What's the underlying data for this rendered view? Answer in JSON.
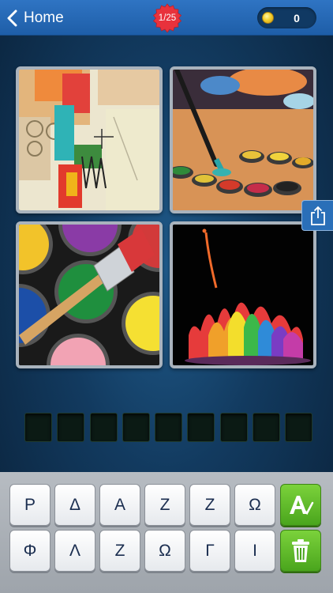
{
  "header": {
    "back_label": "Home",
    "level": "1/25",
    "coins": "0"
  },
  "icons": {
    "back": "chevron-left-icon",
    "coin": "coin-icon",
    "share": "share-icon",
    "hint": "letter-hint-icon",
    "remove": "trash-icon"
  },
  "pictures": [
    {
      "subject": "abstract painting"
    },
    {
      "subject": "paintbrush with watercolor palette"
    },
    {
      "subject": "paint cans with brush"
    },
    {
      "subject": "rainbow paint splash"
    }
  ],
  "answer": {
    "slot_count": 9,
    "letters": [
      "",
      "",
      "",
      "",
      "",
      "",
      "",
      "",
      ""
    ]
  },
  "keyboard": {
    "row1": [
      "Ρ",
      "Δ",
      "Α",
      "Ζ",
      "Ζ",
      "Ω"
    ],
    "row2": [
      "Φ",
      "Λ",
      "Ζ",
      "Ω",
      "Γ",
      "Ι"
    ]
  },
  "colors": {
    "header": "#2f74c3",
    "badge": "#e8323c",
    "action_key": "#5cb82a",
    "key_text": "#1a2d4f"
  }
}
